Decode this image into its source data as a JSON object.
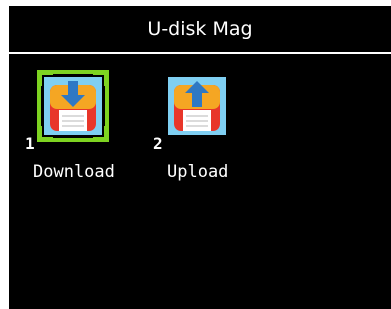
{
  "header": {
    "title": "U-disk Mag"
  },
  "items": [
    {
      "number": "1",
      "label": "Download",
      "icon": "floppy-download-icon",
      "selected": true
    },
    {
      "number": "2",
      "label": "Upload",
      "icon": "floppy-upload-icon",
      "selected": false
    }
  ],
  "colors": {
    "background": "#000000",
    "text": "#ffffff",
    "selection": "#7ed321",
    "icon_frame": "#5bc0eb",
    "disk_orange": "#f5a623",
    "disk_red": "#e8362a",
    "arrow_blue": "#2f78c4"
  }
}
